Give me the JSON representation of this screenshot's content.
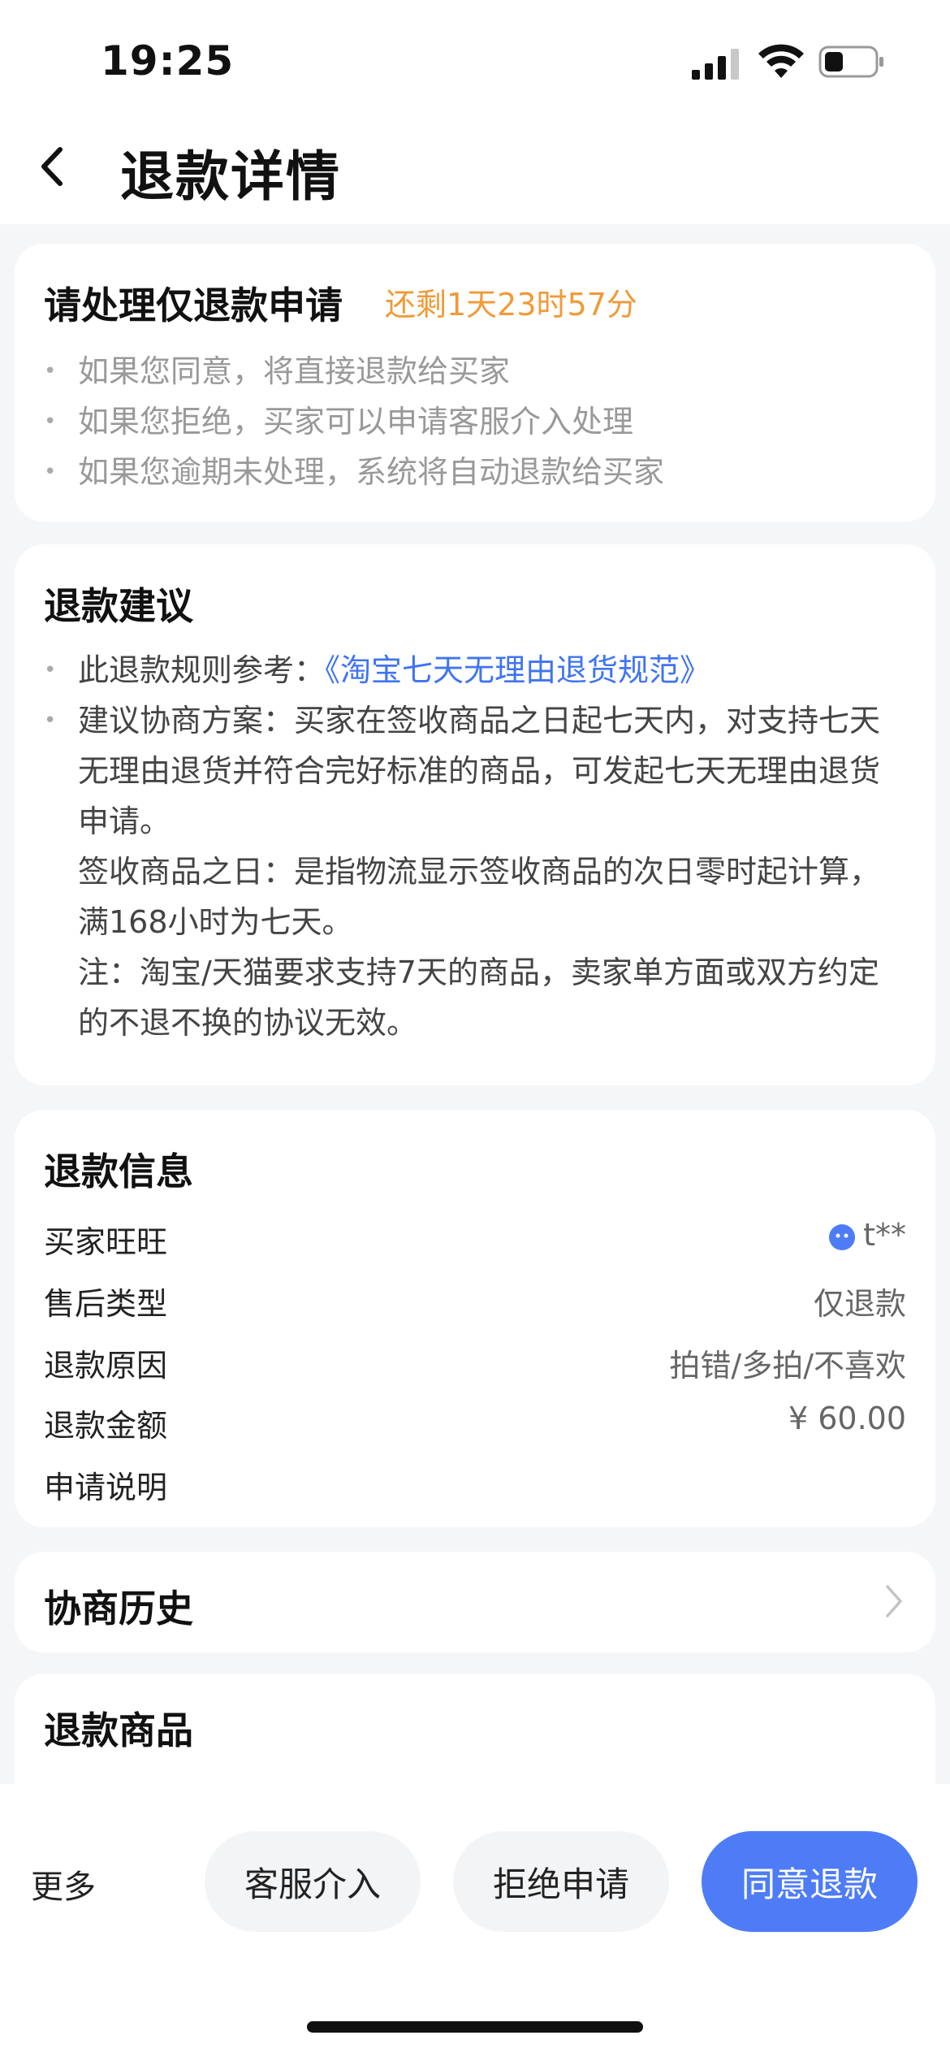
{
  "status_bar": {
    "time": "19:25"
  },
  "nav": {
    "title": "退款详情"
  },
  "process_card": {
    "title": "请处理仅退款申请",
    "countdown": "还剩1天23时57分",
    "bullets": [
      "如果您同意，将直接退款给买家",
      "如果您拒绝，买家可以申请客服介入处理",
      "如果您逾期未处理，系统将自动退款给买家"
    ]
  },
  "advice_card": {
    "title": "退款建议",
    "rule_prefix": "此退款规则参考：",
    "rule_link": "《淘宝七天无理由退货规范》",
    "advice_text": "建议协商方案：买家在签收商品之日起七天内，对支持七天无理由退货并符合完好标准的商品，可发起七天无理由退货申请。",
    "sign_text": "签收商品之日：是指物流显示签收商品的次日零时起计算，满168小时为七天。",
    "note_text": "注：淘宝/天猫要求支持7天的商品，卖家单方面或双方约定的不退不换的协议无效。"
  },
  "info_card": {
    "title": "退款信息",
    "rows": [
      {
        "label": "买家旺旺",
        "value": "t**"
      },
      {
        "label": "售后类型",
        "value": "仅退款"
      },
      {
        "label": "退款原因",
        "value": "拍错/多拍/不喜欢"
      },
      {
        "label": "退款金额",
        "value": "¥ 60.00"
      },
      {
        "label": "申请说明",
        "value": ""
      }
    ]
  },
  "history_card": {
    "title": "协商历史"
  },
  "goods_card": {
    "title": "退款商品"
  },
  "bottom_bar": {
    "more": "更多",
    "service": "客服介入",
    "reject": "拒绝申请",
    "agree": "同意退款"
  },
  "colors": {
    "accent": "#4e7cf6",
    "link": "#3f74f2",
    "countdown": "#f09a37"
  }
}
